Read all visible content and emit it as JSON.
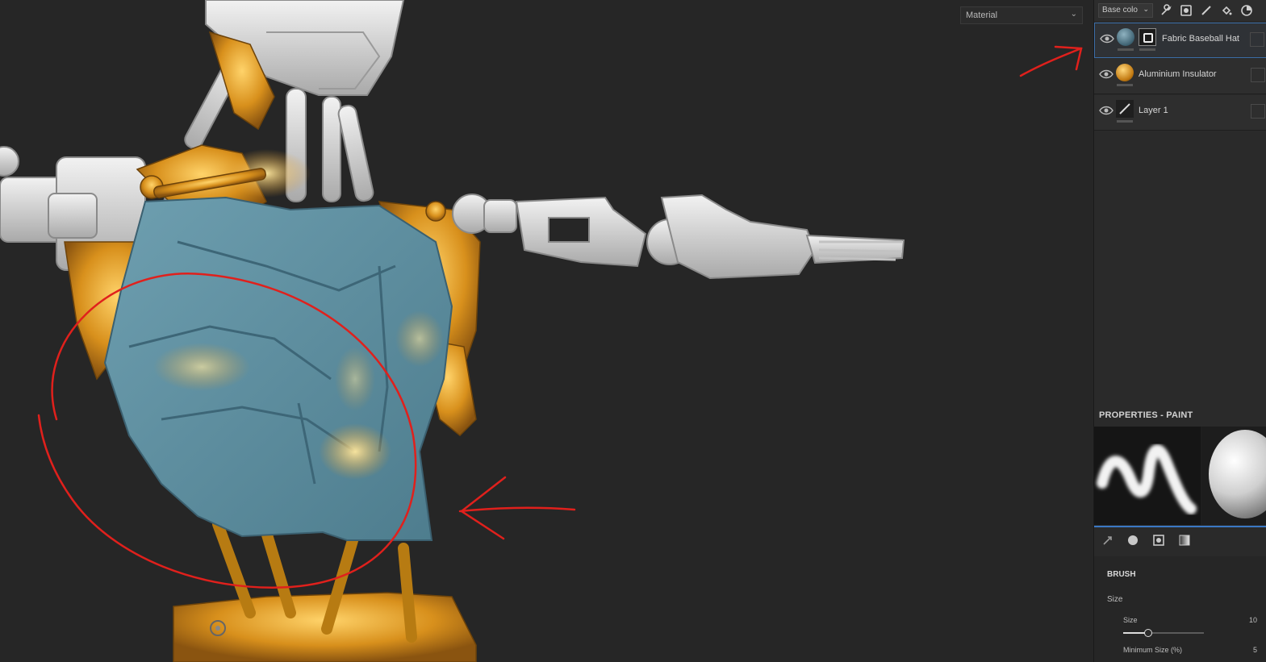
{
  "viewport": {
    "material_select": "Material"
  },
  "layers_panel": {
    "channel_select": "Base colo",
    "toolbar_icons": [
      "wrench-icon",
      "fill-layer-icon",
      "paint-layer-icon",
      "fill-bucket-icon",
      "smart-material-icon"
    ],
    "layers": [
      {
        "name": "Fabric Baseball Hat",
        "thumb": "fabric-material-thumb",
        "selected": true
      },
      {
        "name": "Aluminium Insulator",
        "thumb": "aluminium-material-thumb",
        "selected": false
      },
      {
        "name": "Layer 1",
        "thumb": "brush-layer-thumb",
        "selected": false
      }
    ]
  },
  "properties": {
    "header": "PROPERTIES - PAINT",
    "tabs": [
      "brush-tab-icon",
      "material-tab-icon",
      "mask-tab-icon",
      "gradient-tab-icon"
    ],
    "brush": {
      "title": "BRUSH",
      "size_group": "Size",
      "size_label": "Size",
      "size_value": "10",
      "size_fraction": 0.3,
      "min_size_label": "Minimum Size (%)",
      "min_size_value": "5"
    }
  },
  "colors": {
    "accent": "#3a78c4",
    "annotation": "#e0201c",
    "fabric": "#5e8fa0",
    "gold": "#d89a20",
    "robot_white": "#d8d8d8"
  }
}
